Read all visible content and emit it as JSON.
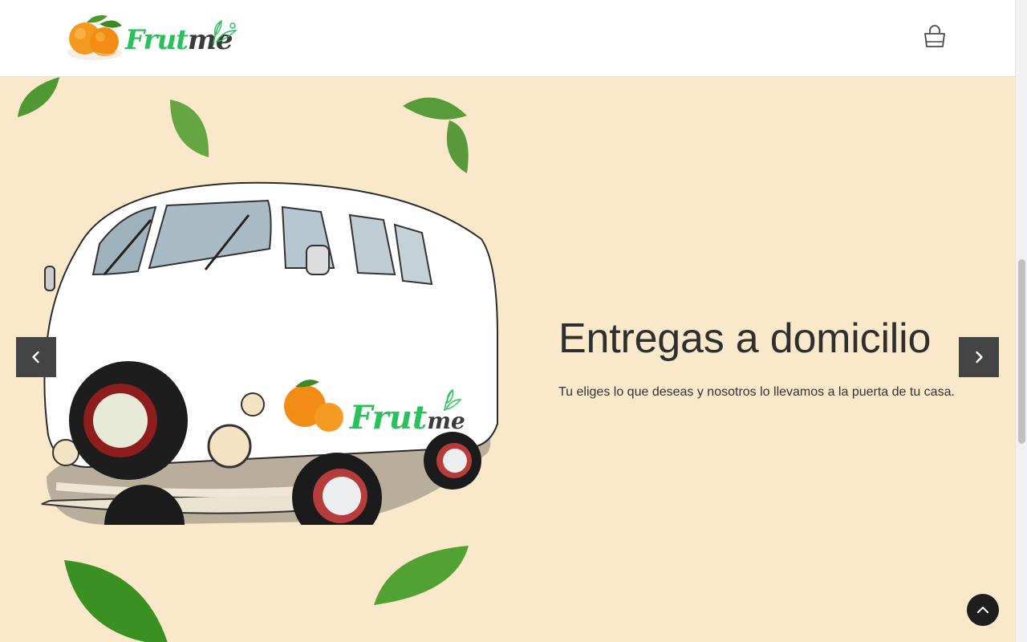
{
  "header": {
    "logo_text_a": "Frut",
    "logo_text_b": "me",
    "cart_icon": "shopping-bag-icon"
  },
  "hero": {
    "title": "Entregas a domicilio",
    "text": "Tu eliges lo que deseas y nosotros lo llevamos a la puerta de tu casa.",
    "van_logo_a": "Frut",
    "van_logo_b": "me",
    "prev_icon": "chevron-left-icon",
    "next_icon": "chevron-right-icon"
  },
  "scroll_top_icon": "chevron-up-icon",
  "colors": {
    "hero_bg": "#f9e8c9",
    "logo_green": "#2bc15a",
    "logo_dark": "#3a3a3a",
    "arrow_bg": "#444444",
    "to_top_bg": "#1e1e1e"
  }
}
